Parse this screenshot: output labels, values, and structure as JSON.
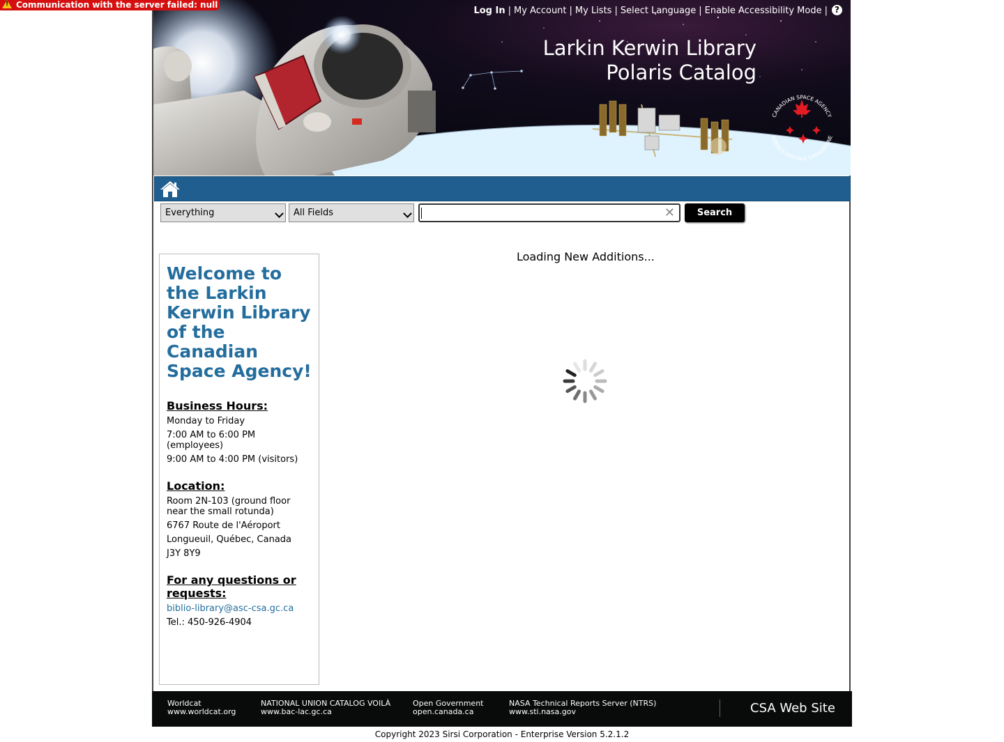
{
  "error_banner": {
    "message": "Communication with the server failed: null"
  },
  "header": {
    "top_links": {
      "login": "Log In",
      "my_account": "My Account",
      "my_lists": "My Lists",
      "select_language": "Select Language",
      "accessibility": "Enable Accessibility Mode",
      "separator": "|",
      "help": "?"
    },
    "title_line1": "Larkin Kerwin Library",
    "title_line2": "Polaris Catalog",
    "logo_text_top": "CANADIAN SPACE AGENCY",
    "logo_text_bottom": "AGENCE SPATIALE CANADIENNE"
  },
  "navbar": {
    "home_icon": "home-icon"
  },
  "search": {
    "library_select": "Everything",
    "field_select": "All Fields",
    "query_value": "",
    "clear_glyph": "✕",
    "button_label": "Search"
  },
  "welcome": {
    "title": "Welcome to the Larkin Kerwin Library of the Canadian Space Agency!",
    "hours_heading": "Business Hours:",
    "hours": [
      "Monday to Friday",
      "7:00 AM to 6:00 PM (employees)",
      "9:00 AM to 4:00 PM (visitors)"
    ],
    "location_heading": "Location:",
    "location": [
      "Room 2N-103 (ground floor near the small rotunda)",
      "6767 Route de l'Aéroport",
      "Longueuil, Québec, Canada",
      "J3Y 8Y9"
    ],
    "questions_heading": "For any questions or requests:",
    "email": "biblio-library@asc-csa.gc.ca",
    "phone": "Tel.: 450-926-4904"
  },
  "main": {
    "loading_text": "Loading New Additions..."
  },
  "footer": {
    "links": [
      {
        "name": "Worldcat",
        "url": "www.worldcat.org"
      },
      {
        "name": "NATIONAL UNION CATALOG VOILÀ",
        "url": "www.bac-lac.gc.ca"
      },
      {
        "name": "Open Government",
        "url": "open.canada.ca"
      },
      {
        "name": "NASA Technical Reports Server (NTRS)",
        "url": "www.sti.nasa.gov"
      }
    ],
    "csa_site": "CSA Web Site",
    "copyright": "Copyright 2023 Sirsi Corporation - Enterprise Version 5.2.1.2"
  },
  "colors": {
    "brand_blue": "#1f5e8f",
    "heading_blue": "#236d9e",
    "error_red": "#d50f0f",
    "footer_black": "#090a0a"
  }
}
